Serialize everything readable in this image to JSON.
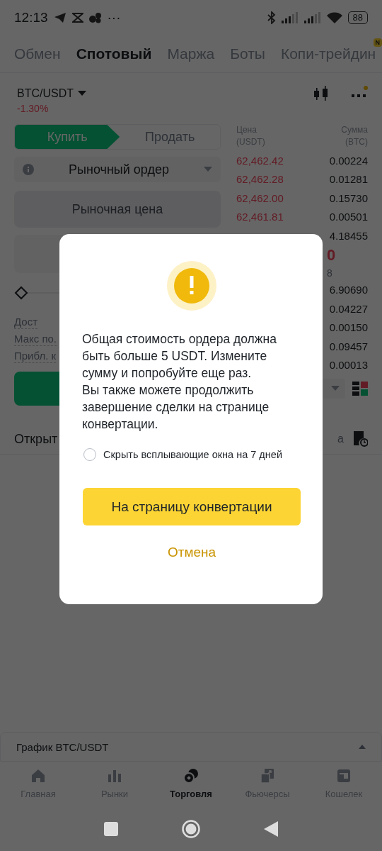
{
  "status_bar": {
    "time": "12:13",
    "more": "···",
    "battery": "88"
  },
  "tabs": [
    {
      "label": "Обмен",
      "selected": false
    },
    {
      "label": "Спотовый",
      "selected": true
    },
    {
      "label": "Маржа",
      "selected": false
    },
    {
      "label": "Боты",
      "selected": false
    },
    {
      "label": "Копи-трейдин",
      "selected": false,
      "badge": "N"
    }
  ],
  "pair": {
    "symbol": "BTC/USDT",
    "change": "-1.30%"
  },
  "trade_form": {
    "sides": [
      {
        "label": "Купить",
        "selected": true
      },
      {
        "label": "Продать",
        "selected": false
      }
    ],
    "order_type": "Рыночный ордер",
    "price_placeholder": "Рыночная цена",
    "info_labels": [
      "Дост",
      "Макс по.",
      "Прибл. к"
    ]
  },
  "orderbook": {
    "price_header": "Цена\n(USDT)",
    "amount_header": "Сумма\n(BTC)",
    "asks": [
      {
        "price": "62,462.42",
        "amount": "0.00224"
      },
      {
        "price": "62,462.28",
        "amount": "0.01281"
      },
      {
        "price": "62,462.00",
        "amount": "0.15730"
      },
      {
        "price": "62,461.81",
        "amount": "0.00501"
      },
      {
        "amount": "4.18455"
      }
    ],
    "last_price_tail": "0",
    "mark_price_tail": "8",
    "bids": [
      {
        "amount": "6.90690"
      },
      {
        "amount": "0.04227"
      },
      {
        "amount": "0.00150"
      },
      {
        "amount": "0.09457"
      },
      {
        "amount": "0.00013"
      }
    ]
  },
  "orders_section": {
    "title": "Открыт",
    "tail": "а"
  },
  "dialog": {
    "message": [
      "Общая стоимость ордера должна быть больше 5 USDT. Измените сумму и попробуйте еще раз.",
      "Вы также можете продолжить завершение сделки на странице конвертации."
    ],
    "checkbox": {
      "label": "Скрыть всплывающие окна на 7 дней",
      "checked": false
    },
    "primary_button": "На страницу конвертации",
    "cancel_button": "Отмена"
  },
  "chart_bar": {
    "label": "График BTC/USDT"
  },
  "bottom_nav": [
    {
      "label": "Главная",
      "kind": "home",
      "selected": false
    },
    {
      "label": "Рынки",
      "kind": "markets",
      "selected": false
    },
    {
      "label": "Торговля",
      "kind": "trade",
      "selected": true
    },
    {
      "label": "Фьючерсы",
      "kind": "futures",
      "selected": false
    },
    {
      "label": "Кошелек",
      "kind": "wallet",
      "selected": false
    }
  ]
}
